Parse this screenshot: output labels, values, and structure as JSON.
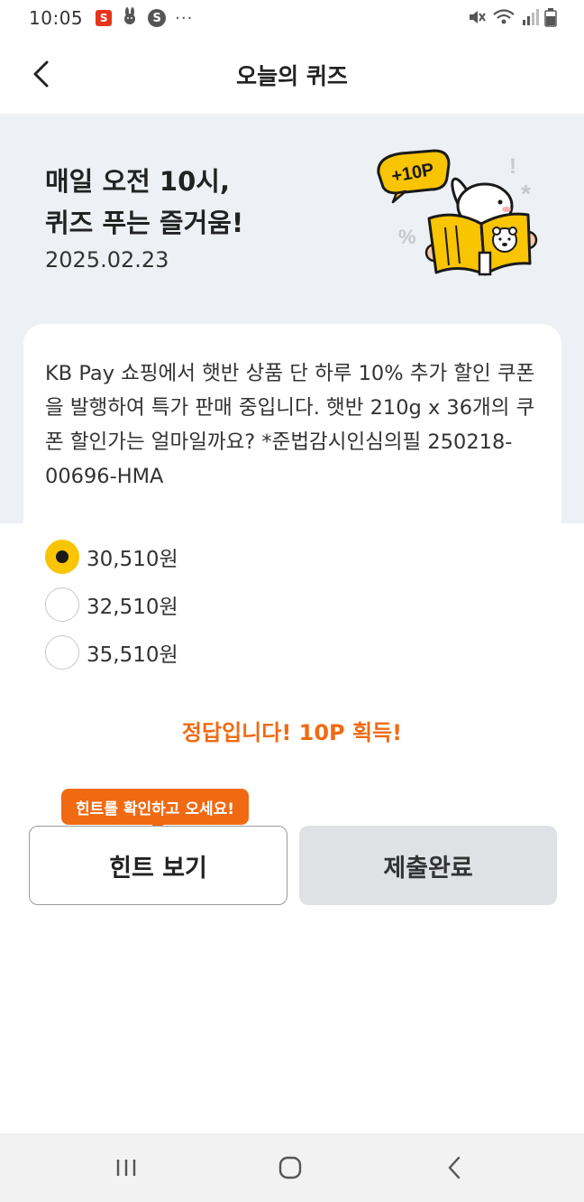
{
  "status_bar": {
    "time": "10:05",
    "app_badge": "S",
    "circle_app": "S",
    "more": "···"
  },
  "header": {
    "title": "오늘의 퀴즈"
  },
  "hero": {
    "title_line1": "매일 오전 10시,",
    "title_line2": "퀴즈 푸는 즐거움!",
    "date": "2025.02.23",
    "badge": "+10P",
    "accent_color": "#f9c400"
  },
  "quiz": {
    "question": "KB Pay 쇼핑에서 햇반 상품 단 하루 10% 추가 할인 쿠폰을 발행하여 특가 판매 중입니다. 햇반 210g x 36개의 쿠폰 할인가는 얼마일까요? *준법감시인심의필 250218-00696-HMA",
    "options": [
      {
        "label": "30,510원",
        "selected": true
      },
      {
        "label": "32,510원",
        "selected": false
      },
      {
        "label": "35,510원",
        "selected": false
      }
    ],
    "result": "정답입니다! 10P 획득!",
    "result_color": "#f06a13"
  },
  "actions": {
    "tooltip": "힌트를 확인하고 오세요!",
    "hint_button": "힌트 보기",
    "submit_button": "제출완료"
  },
  "nav": {
    "recents_icon": "recents-icon",
    "home_icon": "home-icon",
    "back_icon": "back-icon"
  }
}
